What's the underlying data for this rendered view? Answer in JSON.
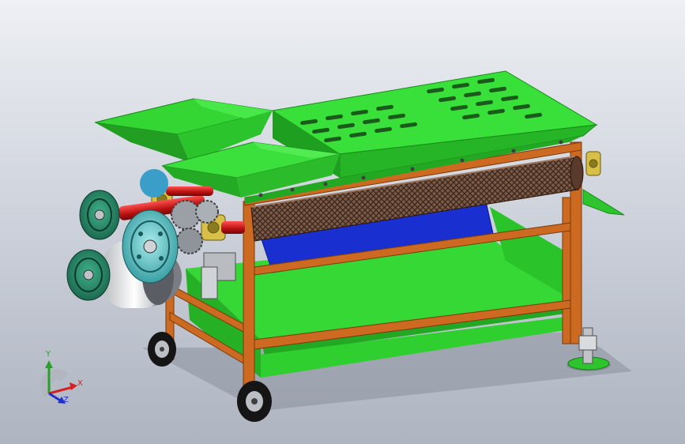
{
  "viewport": {
    "background_top": "#eef0f4",
    "background_bottom": "#aeb4c0"
  },
  "scene": {
    "subject": "threshing-machine-model",
    "colors": {
      "hopper_green": "#2fd42f",
      "hopper_dark": "#1f9a1f",
      "frame_orange": "#c8641e",
      "frame_dark": "#8a4010",
      "pulley_teal": "#2e8f70",
      "pulley_cyan": "#6ecfd0",
      "shaft_red": "#c81818",
      "bearing_yellow": "#d9c24a",
      "screen_blue": "#1a2fd0",
      "drum_mesh": "#5a3a2a"
    }
  },
  "triad": {
    "x_label": "X",
    "y_label": "Y",
    "z_label": "Z",
    "x_color": "#d82020",
    "y_color": "#2aa02a",
    "z_color": "#2030c8"
  }
}
